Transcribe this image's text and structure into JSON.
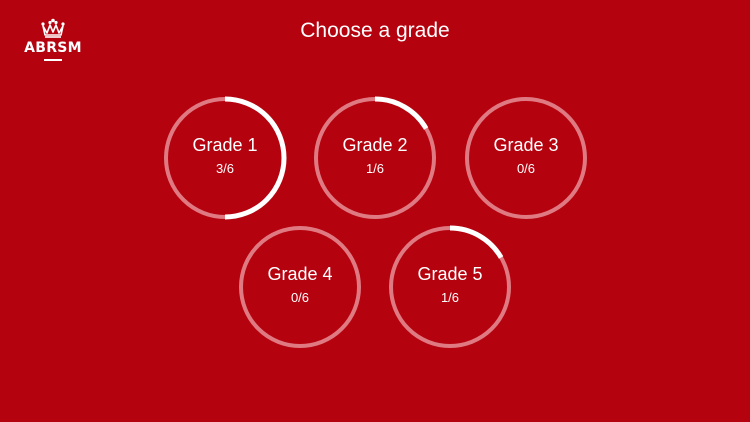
{
  "logo": {
    "text": "ABRSM"
  },
  "header": {
    "title": "Choose a grade"
  },
  "colors": {
    "background": "#b5020f",
    "ring_track": "#df7a82",
    "ring_progress": "#ffffff"
  },
  "grades": [
    {
      "label": "Grade 1",
      "progress_text": "3/6",
      "completed": 3,
      "total": 6
    },
    {
      "label": "Grade 2",
      "progress_text": "1/6",
      "completed": 1,
      "total": 6
    },
    {
      "label": "Grade 3",
      "progress_text": "0/6",
      "completed": 0,
      "total": 6
    },
    {
      "label": "Grade 4",
      "progress_text": "0/6",
      "completed": 0,
      "total": 6
    },
    {
      "label": "Grade 5",
      "progress_text": "1/6",
      "completed": 1,
      "total": 6
    }
  ]
}
